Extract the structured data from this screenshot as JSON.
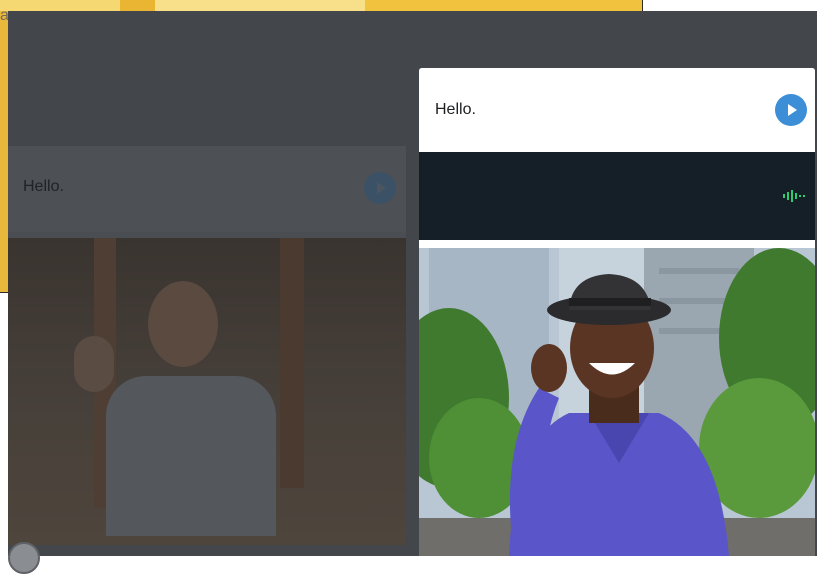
{
  "background_window": {
    "cut_text": "a"
  },
  "lesson": {
    "dimmed_card": {
      "prompt": "Hello."
    },
    "active_card": {
      "prompt": "Hello."
    }
  },
  "icons": {
    "play": "play-icon",
    "audio_wave": "audio-waveform-icon"
  },
  "colors": {
    "overlay": "#43474b",
    "play_button": "#3c8ed6",
    "audio_bar": "#151f27",
    "waveform": "#2ecc71"
  }
}
